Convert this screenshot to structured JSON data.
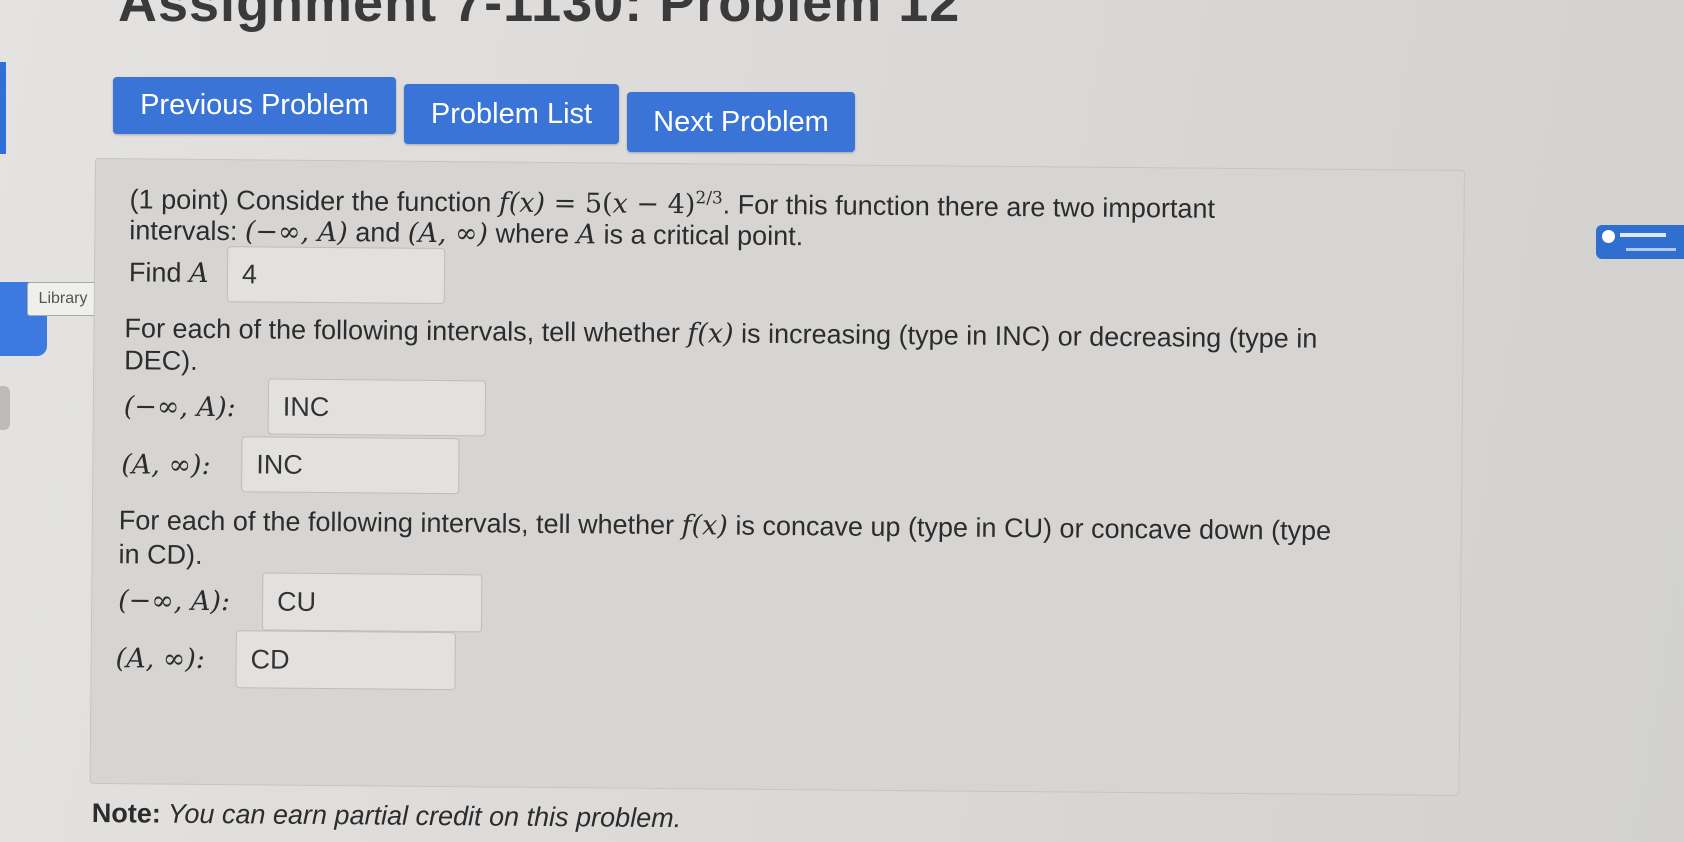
{
  "page": {
    "title": "Assignment 7-1130: Problem 12"
  },
  "nav": {
    "prev_label": "Previous Problem",
    "list_label": "Problem List",
    "next_label": "Next Problem"
  },
  "sidebar": {
    "library_label": "Library"
  },
  "problem": {
    "intro_prefix": "(1 point) Consider the function ",
    "func_lhs": "f(x)",
    "func_eq": " = 5(",
    "func_x": "x",
    "func_minus": " − 4)",
    "func_exp": "2/3",
    "intro_suffix": ". For this function there are two important",
    "line2_prefix": "intervals: ",
    "interval_left": "(−∞, A)",
    "line2_and": " and ",
    "interval_right": "(A, ∞)",
    "line2_where": " where ",
    "var_a": "A",
    "line2_suffix": " is a critical point.",
    "find_label": "Find ",
    "find_var": "A",
    "answer_a": "4",
    "inc_prompt_1": "For each of the following intervals, tell whether ",
    "inc_fx": "f(x)",
    "inc_prompt_2": " is increasing (type in INC) or decreasing (type in",
    "inc_prompt_3": "DEC).",
    "inc_left_label": "(−∞, A):",
    "inc_left_value": "INC",
    "inc_right_label": "(A, ∞):",
    "inc_right_value": "INC",
    "con_prompt_1": "For each of the following intervals, tell whether ",
    "con_fx": "f(x)",
    "con_prompt_2": " is concave up (type in CU) or concave down (type",
    "con_prompt_3": "in CD).",
    "con_left_label": "(−∞, A):",
    "con_left_value": "CU",
    "con_right_label": "(A, ∞):",
    "con_right_value": "CD"
  },
  "note": {
    "bold": "Note:",
    "text": " You can earn partial credit on this problem."
  }
}
